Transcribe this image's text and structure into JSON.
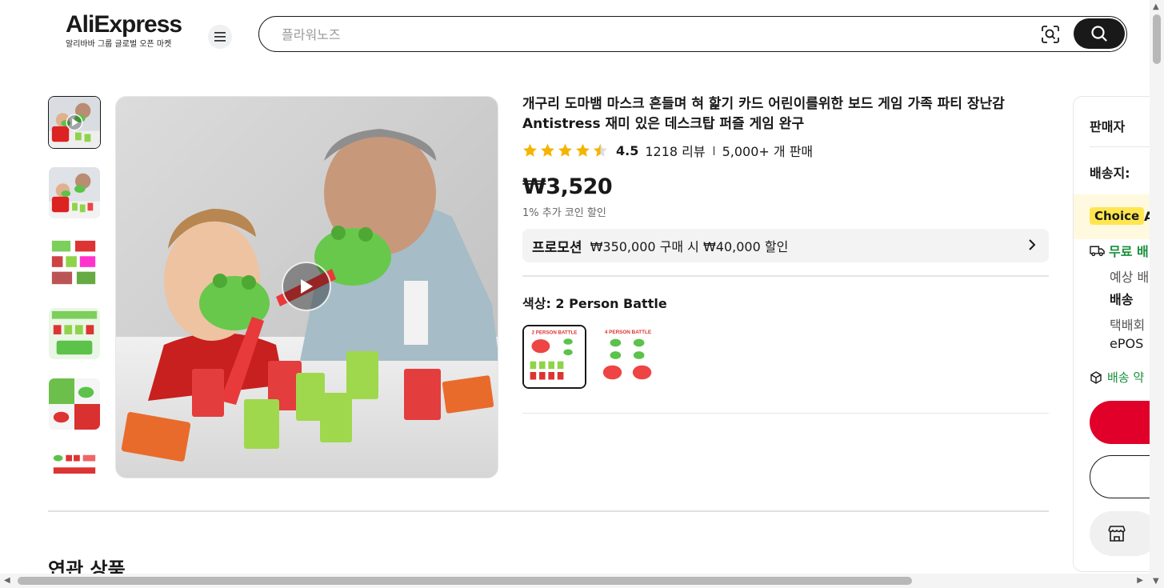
{
  "header": {
    "logo_text": "AliExpress",
    "logo_tagline": "알리바바 그룹 글로벌 오픈 마켓",
    "search_placeholder": "플라워노즈"
  },
  "product": {
    "title": "개구리 도마뱀 마스크 흔들며 혀 핥기 카드 어린이를위한 보드 게임 가족 파티 장난감 Antistress 재미 있은 데스크탑 퍼즐 게임 완구",
    "rating": "4.5",
    "rating_stars": 4.5,
    "reviews": "1218 리뷰",
    "sold": "5,000+ 개 판매",
    "price": "₩3,520",
    "coin_discount": "1% 추가 코인 할인",
    "promo_label": "프로모션",
    "promo_text": "₩350,000 구매 시 ₩40,000 할인",
    "color_label": "색상: 2 Person Battle",
    "swatches": [
      {
        "label": "2 PERSON BATTLE",
        "selected": true
      },
      {
        "label": "4 PERSON BATTLE",
        "selected": false
      }
    ]
  },
  "sections": {
    "related_title": "연관 상품"
  },
  "right_panel": {
    "seller_label": "판매자",
    "ship_to_label": "배송지:",
    "choice_badge": "Choice",
    "choice_after": "A",
    "free_shipping": "무료 배",
    "expected": "예상 배",
    "delivery": "배송",
    "courier": "택배회",
    "epost": "ePOS",
    "delivery_promise": "배송 약"
  },
  "colors": {
    "accent_red": "#e0002a",
    "choice_yellow": "#ffe650",
    "green": "#1a8f3c"
  }
}
